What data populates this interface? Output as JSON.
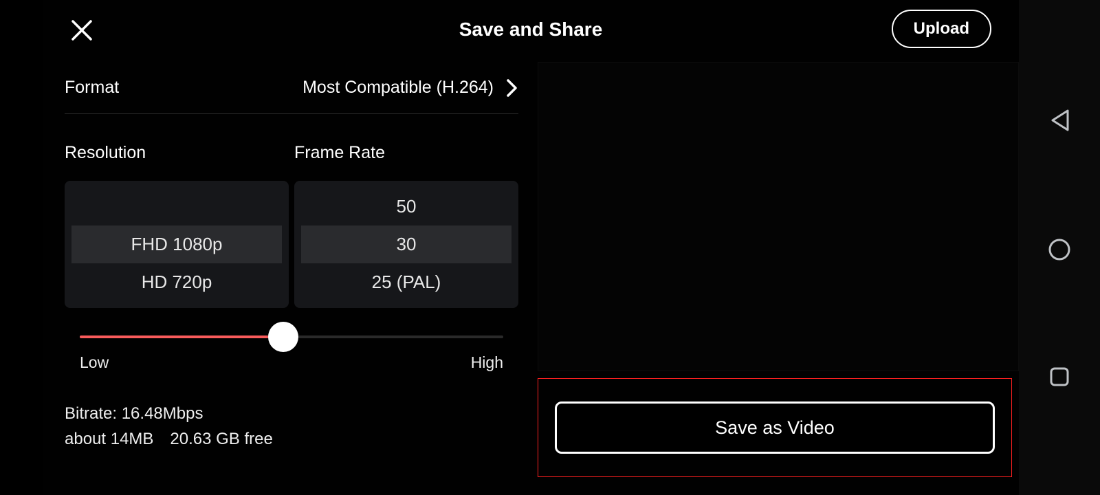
{
  "header": {
    "title": "Save and Share",
    "upload_label": "Upload"
  },
  "format": {
    "label": "Format",
    "value": "Most Compatible (H.264)"
  },
  "resolution": {
    "label": "Resolution",
    "options": [
      "",
      "FHD 1080p",
      "HD 720p"
    ],
    "selected_index": 1
  },
  "framerate": {
    "label": "Frame Rate",
    "options": [
      "50",
      "30",
      "25 (PAL)"
    ],
    "selected_index": 1
  },
  "bitrate_slider": {
    "low_label": "Low",
    "high_label": "High",
    "position_pct": 48
  },
  "info": {
    "bitrate": "Bitrate: 16.48Mbps",
    "size": "about 14MB",
    "free": "20.63 GB free"
  },
  "save_button_label": "Save as Video"
}
